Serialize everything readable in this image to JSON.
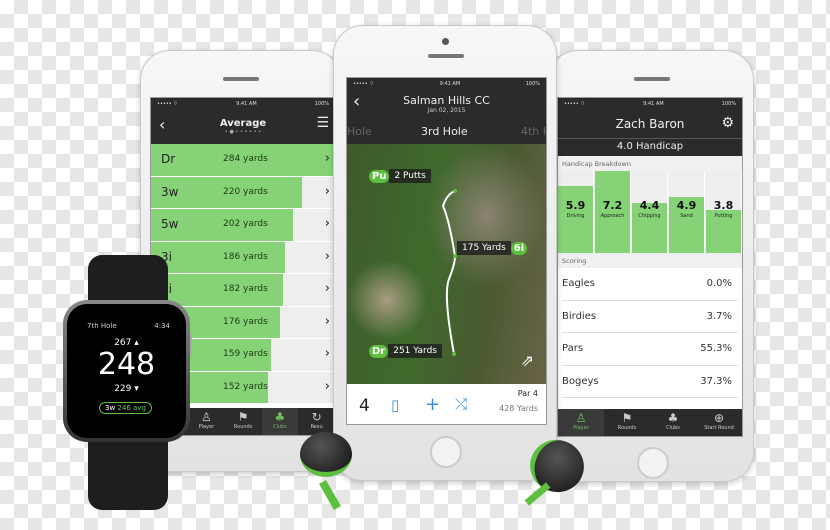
{
  "status": {
    "time": "9:41 AM",
    "battery": "100%",
    "signal": "••••• ⌔"
  },
  "left_phone": {
    "title": "Average",
    "clubs": [
      {
        "label": "Dr",
        "value": "284 yards",
        "yards": 284
      },
      {
        "label": "3w",
        "value": "220 yards",
        "yards": 220
      },
      {
        "label": "5w",
        "value": "202 yards",
        "yards": 202
      },
      {
        "label": "3i",
        "value": "186 yards",
        "yards": 186
      },
      {
        "label": "4i",
        "value": "182 yards",
        "yards": 182
      },
      {
        "label": "",
        "value": "176 yards",
        "yards": 176
      },
      {
        "label": "",
        "value": "159 yards",
        "yards": 159
      },
      {
        "label": "",
        "value": "152 yards",
        "yards": 152
      }
    ],
    "tabs": [
      "Player",
      "Rounds",
      "Clubs",
      "Resu"
    ]
  },
  "middle_phone": {
    "course": "Salman Hills CC",
    "date": "Jan 02, 2015",
    "prev_hole": "Hole",
    "hole": "3rd Hole",
    "next_hole": "4th H",
    "shots": [
      {
        "club": "Pu",
        "text": "2 Putts"
      },
      {
        "club": "6i",
        "text": "175 Yards"
      },
      {
        "club": "Dr",
        "text": "251 Yards"
      }
    ],
    "strokes": "4",
    "par": "Par 4",
    "yards": "428 Yards"
  },
  "right_phone": {
    "name": "Zach Baron",
    "handicap": "4.0 Handicap",
    "breakdown_title": "Handicap Breakdown",
    "breakdown": [
      {
        "name": "Driving",
        "value": 5.9
      },
      {
        "name": "Approach",
        "value": 7.2
      },
      {
        "name": "Chipping",
        "value": 4.4
      },
      {
        "name": "Sand",
        "value": 4.9
      },
      {
        "name": "Putting",
        "value": 3.8
      }
    ],
    "scoring_title": "Scoring",
    "scoring": [
      {
        "label": "Eagles",
        "value": "0.0%"
      },
      {
        "label": "Birdies",
        "value": "3.7%"
      },
      {
        "label": "Pars",
        "value": "55.3%"
      },
      {
        "label": "Bogeys",
        "value": "37.3%"
      }
    ],
    "tabs": [
      "Player",
      "Rounds",
      "Clubs",
      "Start Round"
    ]
  },
  "watch": {
    "hole": "7th Hole",
    "time": "4:34",
    "max": "267",
    "distance": "248",
    "min": "229",
    "club": "3w",
    "avg": "246 avg"
  },
  "colors": {
    "accent": "#86d276",
    "brand_green": "#5cbf3d",
    "dark": "#2b2b2b"
  }
}
